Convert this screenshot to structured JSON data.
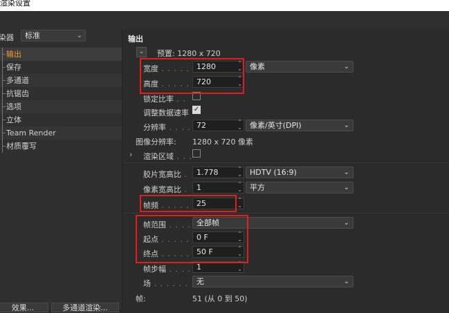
{
  "window": {
    "title": "渲染设置"
  },
  "left_panel": {
    "renderer_label": "染器",
    "renderer_value": "标准",
    "nav_items": [
      "输出",
      "保存",
      "多通道",
      "抗锯齿",
      "选项",
      "立体",
      "Team Render",
      "材质覆写"
    ],
    "bottom_buttons": [
      "效果...",
      "多通道渲染..."
    ]
  },
  "output": {
    "section_title": "输出",
    "preset": "预置: 1280 x 720",
    "width_label": "宽度",
    "width_value": "1280",
    "height_label": "高度",
    "height_value": "720",
    "size_unit": "像素",
    "lock_ratio_label": "锁定比率",
    "adjust_rate_label": "调整数据速率",
    "resolution_label": "分辨率",
    "resolution_value": "72",
    "resolution_unit": "像素/英寸(DPI)",
    "image_resolution_label": "图像分辨率:",
    "image_resolution_value": "1280 x 720 像素",
    "render_region_label": "渲染区域",
    "film_aspect_label": "胶片宽高比",
    "film_aspect_value": "1.778",
    "film_aspect_preset": "HDTV (16:9)",
    "pixel_aspect_label": "像素宽高比",
    "pixel_aspect_value": "1",
    "pixel_aspect_preset": "平方",
    "frame_rate_label": "帧频",
    "frame_rate_value": "25",
    "frame_range_label": "帧范围",
    "frame_range_value": "全部帧",
    "start_label": "起点",
    "start_value": "0 F",
    "end_label": "终点",
    "end_value": "50 F",
    "frame_step_label": "帧步幅",
    "frame_step_value": "1",
    "field_label": "场",
    "field_value": "无",
    "frames_label": "帧:",
    "frames_value": "51 (从 0 到 50)"
  },
  "colors": {
    "accent": "#f29b34",
    "highlight": "#e0201f"
  }
}
